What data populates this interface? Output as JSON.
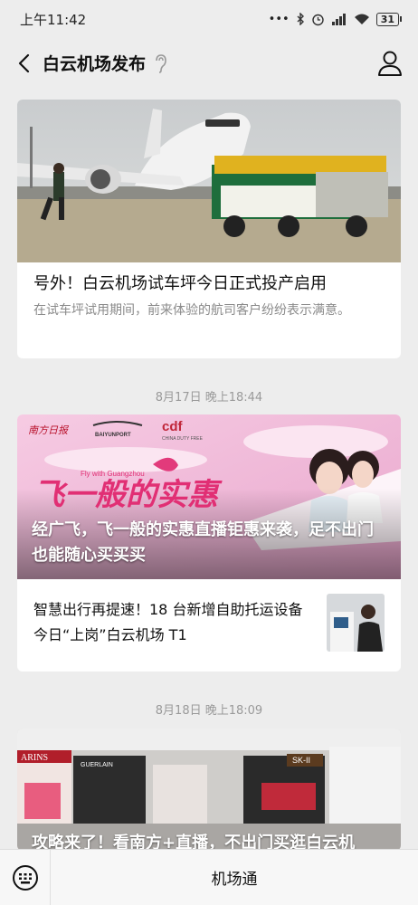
{
  "status": {
    "time": "上午11:42",
    "battery": "31"
  },
  "header": {
    "title": "白云机场发布"
  },
  "articles": [
    {
      "title": "号外！白云机场试车坪今日正式投产启用",
      "desc": "在试车坪试用期间，前来体验的航司客户纷纷表示满意。"
    },
    {
      "timestamp": "8月17日 晚上18:44",
      "banner_logos": [
        "南方日报",
        "BAIYUNPORT",
        "cdf",
        "CHINA DUTY FREE"
      ],
      "banner_slogan": "飞一般的实惠",
      "banner_small": "Fly with Guangzhou",
      "overlay_title": "经广飞，飞一般的实惠直播钜惠来袭，足不出门也能随心买买买",
      "sub_title": "智慧出行再提速！18 台新增自助托运设备今日“上岗”白云机场 T1"
    },
    {
      "timestamp": "8月18日 晚上18:09",
      "overlay_title": "攻略来了！看南方+直播，不出门买逛白云机",
      "store_signs": [
        "ARINS",
        "GUERLAIN",
        "SK-II"
      ]
    }
  ],
  "bottom_menu": {
    "item": "机场通"
  }
}
